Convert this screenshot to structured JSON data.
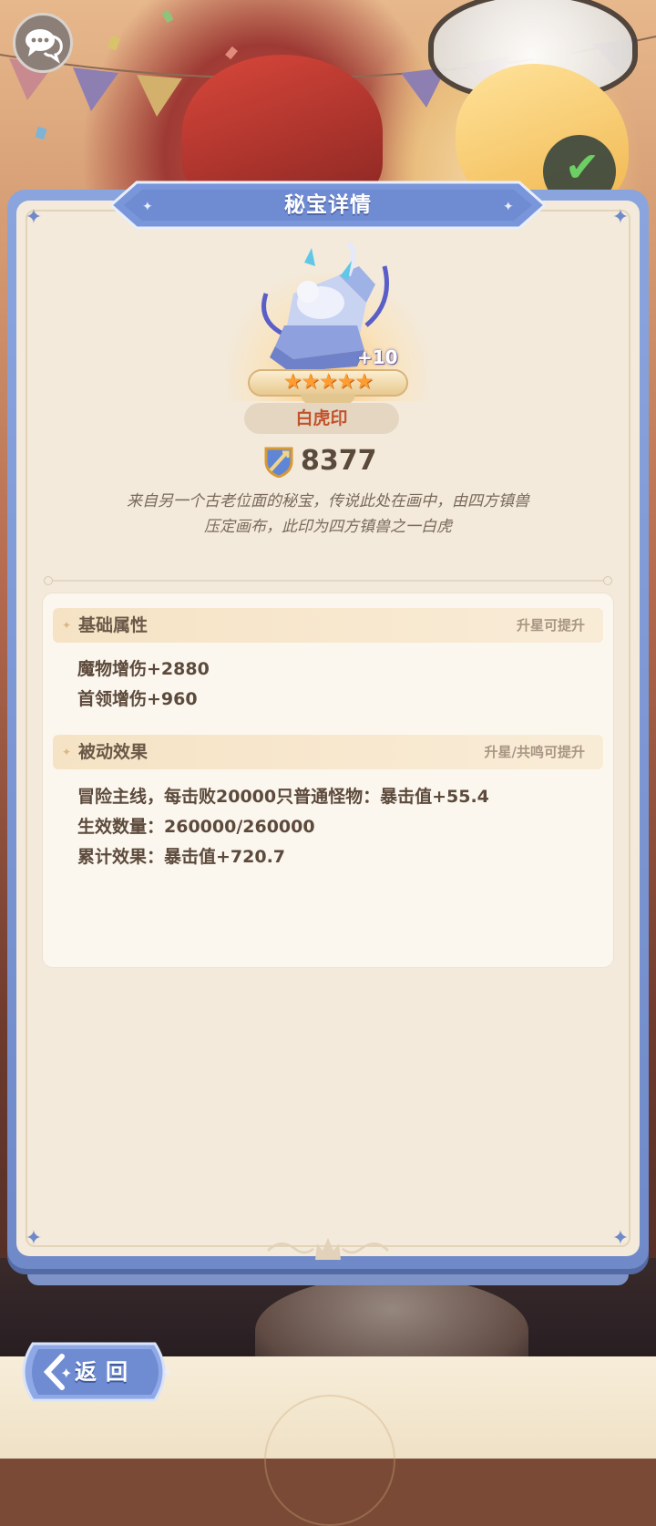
{
  "dialog": {
    "title": "秘宝详情"
  },
  "item": {
    "name": "白虎印",
    "level_label": "+10",
    "stars": 5,
    "stars_text": "★★★★★",
    "power": "8377",
    "description_line1": "来自另一个古老位面的秘宝，传说此处在画中，由四方镇兽",
    "description_line2": "压定画布，此印为四方镇兽之一白虎"
  },
  "base_stats": {
    "title": "基础属性",
    "note": "升星可提升",
    "lines": [
      "魔物增伤+2880",
      "首领增伤+960"
    ]
  },
  "passive": {
    "title": "被动效果",
    "note": "升星/共鸣可提升",
    "lines": [
      "冒险主线，每击败20000只普通怪物：暴击值+55.4",
      "生效数量：260000/260000",
      "累计效果：暴击值+720.7"
    ]
  },
  "back_button": {
    "label": "返回"
  },
  "icons": {
    "chat": "chat-bubbles-icon",
    "power": "sword-shield-icon",
    "back": "chevron-left-icon",
    "confirm": "checkmark-icon"
  },
  "colors": {
    "panel_blue": "#7c97d6",
    "parchment": "#f3eadb",
    "name_red": "#c1532c",
    "star_orange": "#ff9d2e"
  }
}
